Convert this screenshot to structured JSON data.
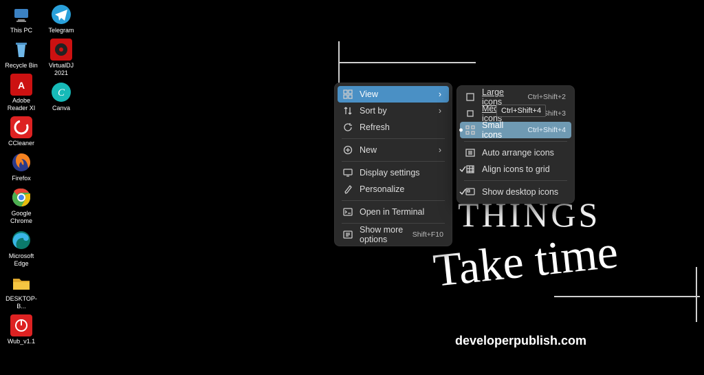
{
  "desktop": {
    "col1": [
      {
        "name": "this-pc",
        "label": "This PC",
        "svg": "pc"
      },
      {
        "name": "recycle-bin",
        "label": "Recycle Bin",
        "svg": "bin"
      },
      {
        "name": "adobe-reader",
        "label": "Adobe Reader XI",
        "svg": "adobe"
      },
      {
        "name": "ccleaner",
        "label": "CCleaner",
        "svg": "ccleaner"
      },
      {
        "name": "firefox",
        "label": "Firefox",
        "svg": "firefox"
      },
      {
        "name": "chrome",
        "label": "Google Chrome",
        "svg": "chrome"
      },
      {
        "name": "edge",
        "label": "Microsoft Edge",
        "svg": "edge"
      },
      {
        "name": "desktop-folder",
        "label": "DESKTOP-B...",
        "svg": "folder"
      },
      {
        "name": "wub",
        "label": "Wub_v1.1",
        "svg": "wub"
      }
    ],
    "col2": [
      {
        "name": "telegram",
        "label": "Telegram",
        "svg": "telegram"
      },
      {
        "name": "virtualdj",
        "label": "VirtualDJ 2021",
        "svg": "vdj"
      },
      {
        "name": "canva",
        "label": "Canva",
        "svg": "canva"
      }
    ]
  },
  "wallpaper": {
    "heading": "THINGS",
    "script": "Take time",
    "footer": "developerpublish.com"
  },
  "ctx_main": [
    {
      "type": "item",
      "icon": "grid",
      "label": "View",
      "chev": true,
      "hover": true
    },
    {
      "type": "item",
      "icon": "sort",
      "label": "Sort by",
      "chev": true
    },
    {
      "type": "item",
      "icon": "refresh",
      "label": "Refresh"
    },
    {
      "type": "sep"
    },
    {
      "type": "item",
      "icon": "plus",
      "label": "New",
      "chev": true
    },
    {
      "type": "sep"
    },
    {
      "type": "item",
      "icon": "display",
      "label": "Display settings"
    },
    {
      "type": "item",
      "icon": "brush",
      "label": "Personalize"
    },
    {
      "type": "sep"
    },
    {
      "type": "item",
      "icon": "terminal",
      "label": "Open in Terminal"
    },
    {
      "type": "sep"
    },
    {
      "type": "item",
      "icon": "more",
      "label": "Show more options",
      "short": "Shift+F10"
    }
  ],
  "ctx_sub": [
    {
      "type": "item",
      "icon": "lg",
      "label": "Large icons",
      "short": "Ctrl+Shift+2",
      "underline": true
    },
    {
      "type": "item",
      "icon": "md",
      "label": "Medium icons",
      "short": "Ctrl+Shift+3",
      "underline": true
    },
    {
      "type": "item",
      "icon": "sm",
      "label": "Small icons",
      "short": "Ctrl+Shift+4",
      "sel": true,
      "dot": true
    },
    {
      "type": "sep"
    },
    {
      "type": "item",
      "icon": "auto",
      "label": "Auto arrange icons"
    },
    {
      "type": "item",
      "icon": "align",
      "label": "Align icons to grid",
      "check": true
    },
    {
      "type": "sep"
    },
    {
      "type": "item",
      "icon": "show",
      "label": "Show desktop icons",
      "check": true
    }
  ],
  "tooltip": "Ctrl+Shift+4"
}
